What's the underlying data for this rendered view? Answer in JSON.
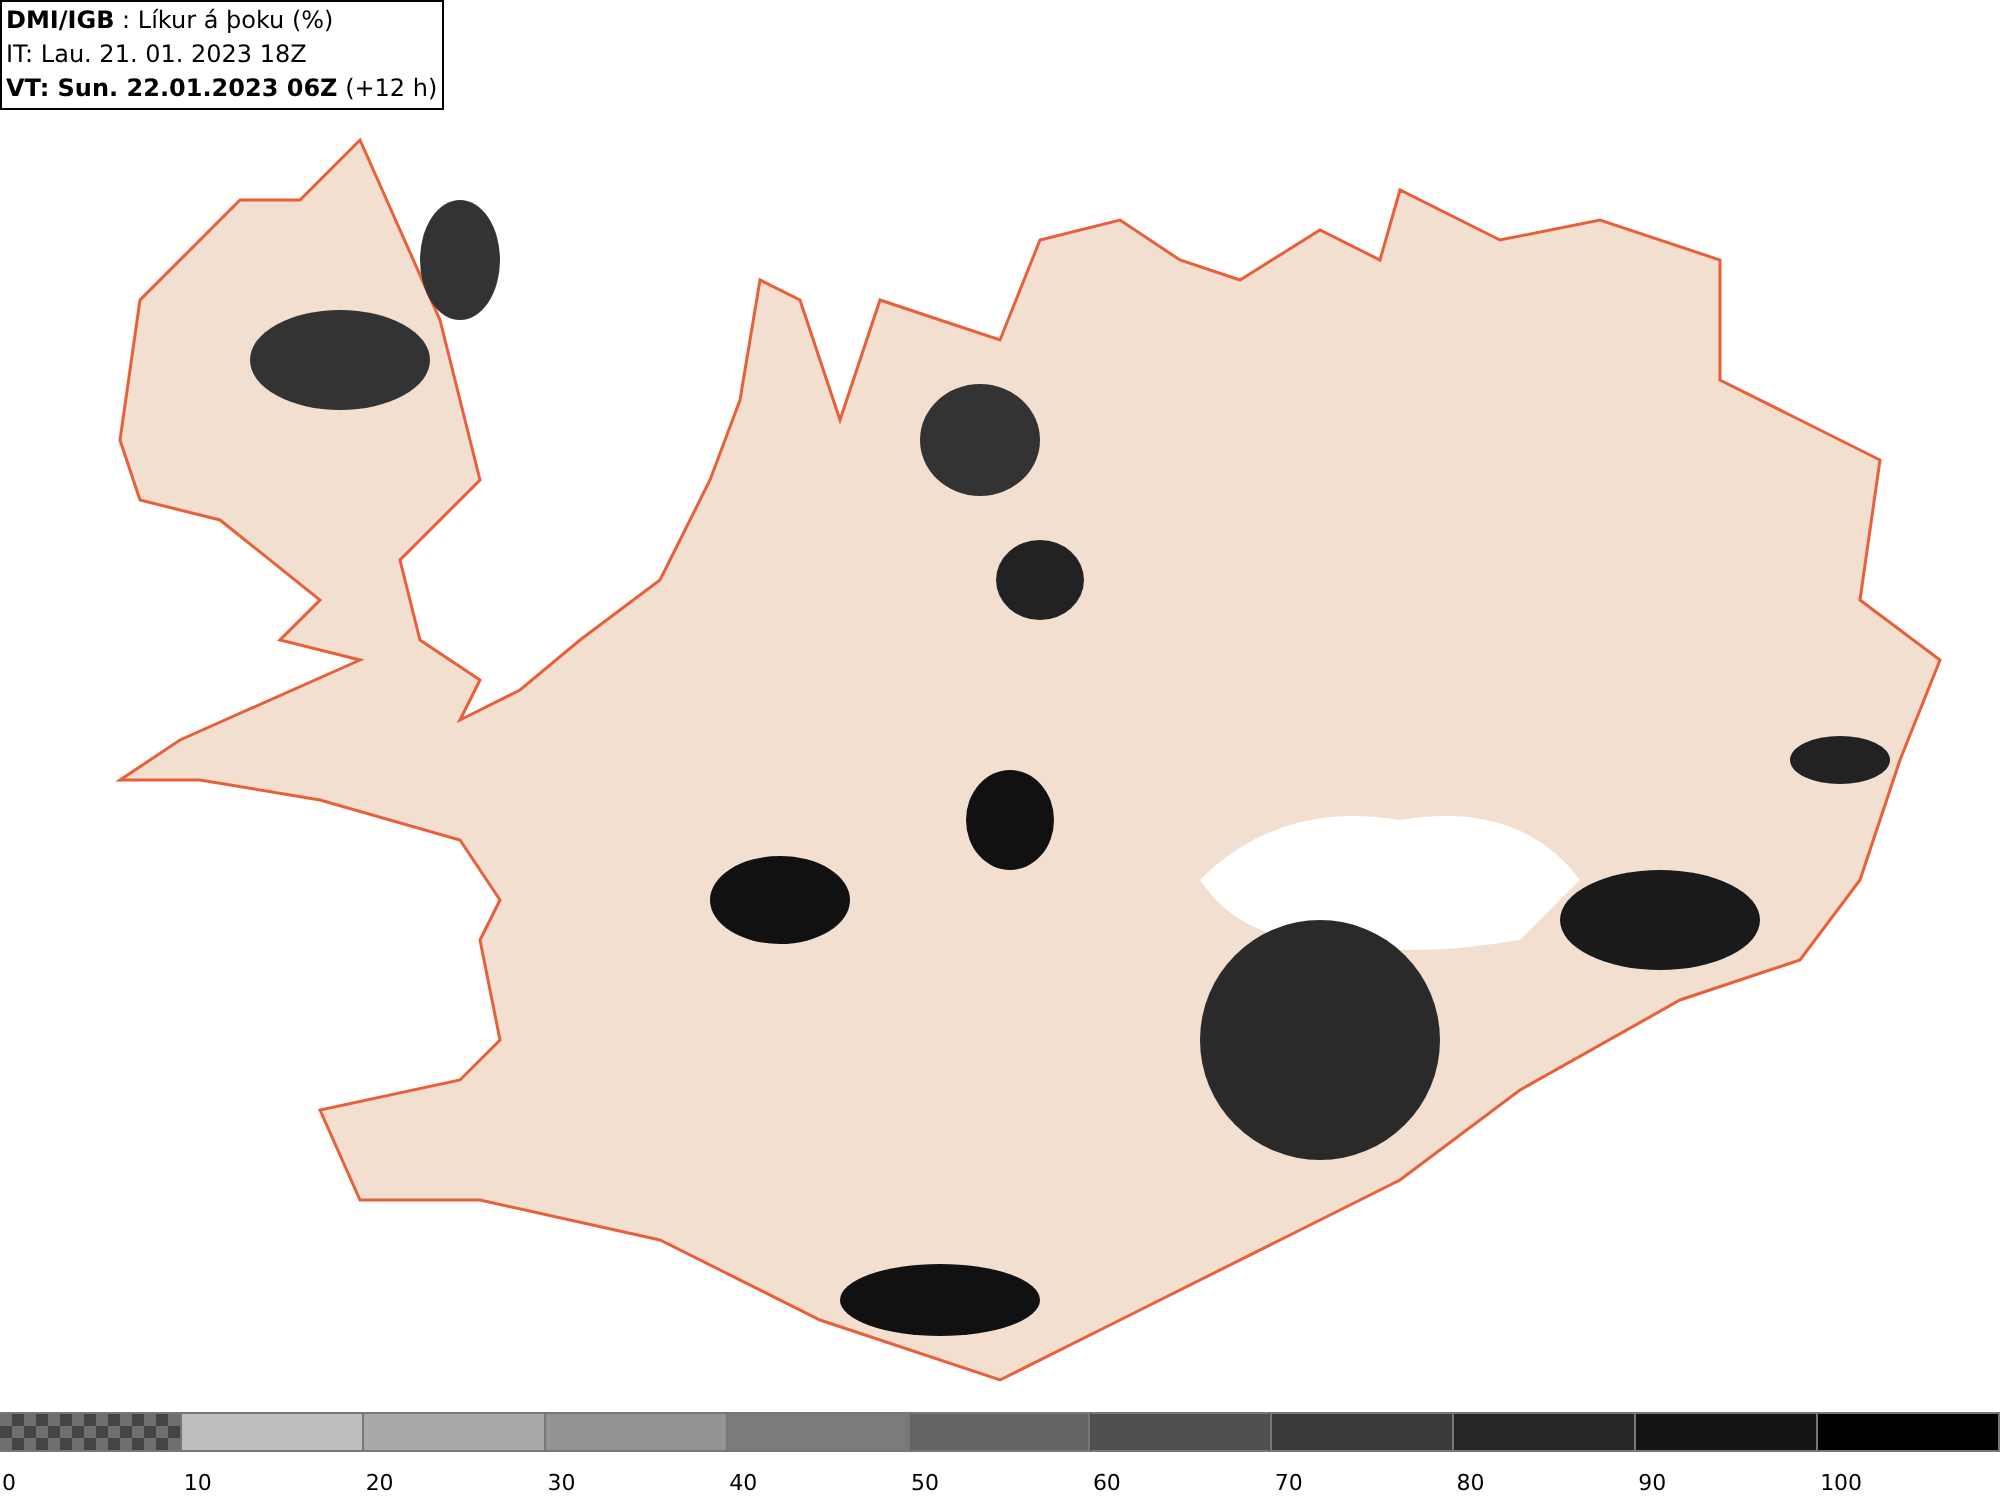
{
  "info_box": {
    "lines": [
      "**DMI/IGB** : Líkur á þoku (%)",
      "IT: Lau. 21. 01. 2023 18Z",
      "**VT: Sun. 22.01.2023 06Z** (+12 h)"
    ]
  },
  "legend": [
    {
      "label": "0",
      "color": "#6e6e6e",
      "kind": "checker"
    },
    {
      "label": "10",
      "color": "#bdbdbd",
      "kind": "solid"
    },
    {
      "label": "20",
      "color": "#a8a8a8",
      "kind": "solid"
    },
    {
      "label": "30",
      "color": "#939393",
      "kind": "solid"
    },
    {
      "label": "40",
      "color": "#7b7b7b",
      "kind": "solid"
    },
    {
      "label": "50",
      "color": "#646464",
      "kind": "solid"
    },
    {
      "label": "60",
      "color": "#505050",
      "kind": "solid"
    },
    {
      "label": "70",
      "color": "#3a3a3a",
      "kind": "solid"
    },
    {
      "label": "80",
      "color": "#262626",
      "kind": "solid"
    },
    {
      "label": "90",
      "color": "#141414",
      "kind": "solid"
    },
    {
      "label": "100",
      "color": "#000000",
      "kind": "solid"
    }
  ]
}
